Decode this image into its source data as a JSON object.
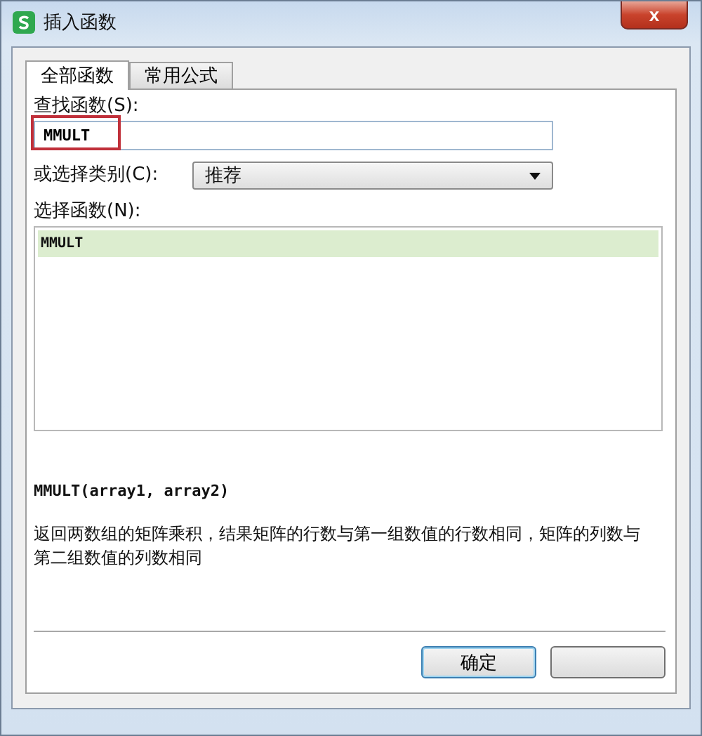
{
  "window": {
    "title": "插入函数",
    "close": "x"
  },
  "tabs": [
    {
      "label": "全部函数",
      "selected": true
    },
    {
      "label": "常用公式",
      "selected": false
    }
  ],
  "search": {
    "label": "查找函数(S):",
    "value": "MMULT",
    "highlighted": true
  },
  "category": {
    "label": "或选择类别(C):",
    "value": "推荐"
  },
  "functions": {
    "label": "选择函数(N):",
    "items": [
      {
        "name": "MMULT",
        "selected": true
      }
    ]
  },
  "signature": "MMULT(array1, array2)",
  "description": "返回两数组的矩阵乘积，结果矩阵的行数与第一组数值的行数相同，矩阵的列数与第二组数值的列数相同",
  "buttons": [
    {
      "label": "确定",
      "kind": "default"
    },
    {
      "kind": "hidden-label"
    }
  ]
}
